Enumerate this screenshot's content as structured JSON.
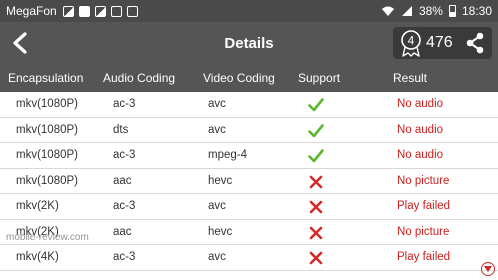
{
  "status_bar": {
    "carrier": "MegaFon",
    "battery": "38%",
    "time": "18:30"
  },
  "app_bar": {
    "title": "Details",
    "badge_number": "4",
    "score": "476"
  },
  "table": {
    "headers": {
      "encapsulation": "Encapsulation",
      "audio": "Audio Coding",
      "video": "Video Coding",
      "support": "Support",
      "result": "Result"
    },
    "rows": [
      {
        "encapsulation": "mkv(1080P)",
        "audio": "ac-3",
        "video": "avc",
        "support": "yes",
        "result": "No audio"
      },
      {
        "encapsulation": "mkv(1080P)",
        "audio": "dts",
        "video": "avc",
        "support": "yes",
        "result": "No audio"
      },
      {
        "encapsulation": "mkv(1080P)",
        "audio": "ac-3",
        "video": "mpeg-4",
        "support": "yes",
        "result": "No audio"
      },
      {
        "encapsulation": "mkv(1080P)",
        "audio": "aac",
        "video": "hevc",
        "support": "no",
        "result": "No picture"
      },
      {
        "encapsulation": "mkv(2K)",
        "audio": "ac-3",
        "video": "avc",
        "support": "no",
        "result": "Play failed"
      },
      {
        "encapsulation": "mkv(2K)",
        "audio": "aac",
        "video": "hevc",
        "support": "no",
        "result": "No picture"
      },
      {
        "encapsulation": "mkv(4K)",
        "audio": "ac-3",
        "video": "avc",
        "support": "no",
        "result": "Play failed"
      }
    ]
  },
  "watermark": "mobile-review.com",
  "colors": {
    "header_bg": "#555555",
    "status_bg": "#4a4a4a",
    "check": "#5cb531",
    "cross": "#d62b2b",
    "result_text": "#cc1f1f"
  }
}
